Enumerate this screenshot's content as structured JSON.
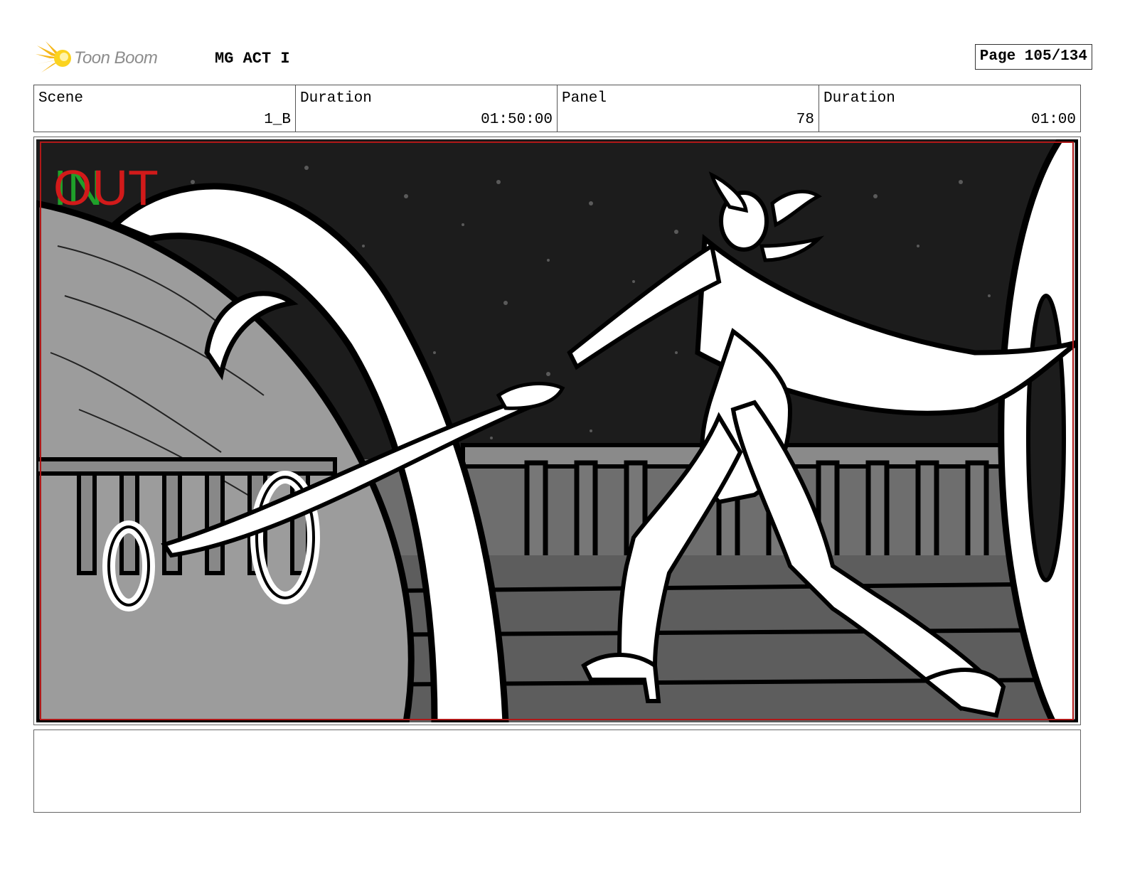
{
  "header": {
    "logo_text": "Toon Boom",
    "project_title": "MG ACT I",
    "page_label": "Page 105/134"
  },
  "info": {
    "scene_label": "Scene",
    "scene_value": "1_B",
    "scene_duration_label": "Duration",
    "scene_duration_value": "01:50:00",
    "panel_label": "Panel",
    "panel_value": "78",
    "panel_duration_label": "Duration",
    "panel_duration_value": "01:00"
  },
  "panel": {
    "in_marker": "IN",
    "out_marker": "OUT",
    "in_color": "#1fa02a",
    "out_color": "#d11a1a",
    "safe_frame_color": "#b01818"
  },
  "notes": {
    "text": ""
  }
}
